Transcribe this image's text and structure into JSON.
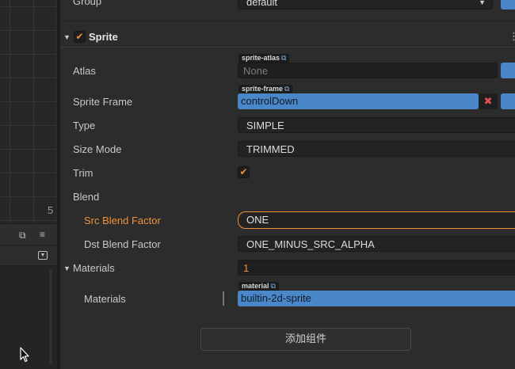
{
  "scene": {
    "tick_label": "5"
  },
  "inspector": {
    "group": {
      "label": "Group",
      "value": "default"
    },
    "sprite": {
      "title": "Sprite",
      "enabled": true,
      "atlas": {
        "label": "Atlas",
        "tag": "sprite-atlas",
        "value": "None"
      },
      "sprite_frame": {
        "label": "Sprite Frame",
        "tag": "sprite-frame",
        "value": "controlDown",
        "clear": "✖"
      },
      "type": {
        "label": "Type",
        "value": "SIMPLE"
      },
      "size_mode": {
        "label": "Size Mode",
        "value": "TRIMMED"
      },
      "trim": {
        "label": "Trim",
        "checked": true
      },
      "blend": {
        "label": "Blend"
      },
      "src_blend": {
        "label": "Src Blend Factor",
        "value": "ONE"
      },
      "dst_blend": {
        "label": "Dst Blend Factor",
        "value": "ONE_MINUS_SRC_ALPHA"
      },
      "materials": {
        "label": "Materials",
        "count": "1",
        "item_label": "Materials",
        "tag": "material",
        "value": "builtin-2d-sprite"
      }
    },
    "add_component": "添加组件"
  },
  "colors": {
    "accent_orange": "#f0913a",
    "asset_blue": "#4a87c9",
    "panel_bg": "#2c2c2c"
  }
}
